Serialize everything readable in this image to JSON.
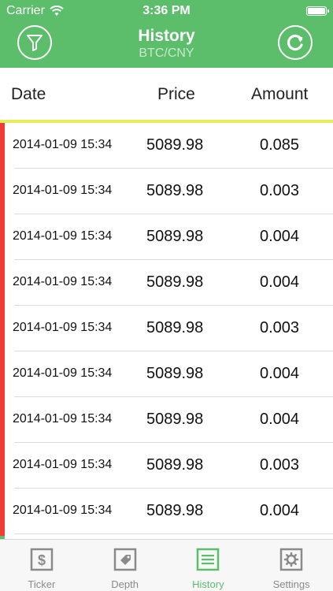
{
  "status_bar": {
    "carrier": "Carrier",
    "time": "3:36 PM"
  },
  "nav": {
    "title": "History",
    "subtitle": "BTC/CNY",
    "left_icon": "filter-icon",
    "right_icon": "refresh-icon"
  },
  "columns": {
    "date": "Date",
    "price": "Price",
    "amount": "Amount"
  },
  "trades": [
    {
      "date": "2014-01-09 15:34",
      "price": "5089.98",
      "amount": "0.085"
    },
    {
      "date": "2014-01-09 15:34",
      "price": "5089.98",
      "amount": "0.003"
    },
    {
      "date": "2014-01-09 15:34",
      "price": "5089.98",
      "amount": "0.004"
    },
    {
      "date": "2014-01-09 15:34",
      "price": "5089.98",
      "amount": "0.004"
    },
    {
      "date": "2014-01-09 15:34",
      "price": "5089.98",
      "amount": "0.003"
    },
    {
      "date": "2014-01-09 15:34",
      "price": "5089.98",
      "amount": "0.004"
    },
    {
      "date": "2014-01-09 15:34",
      "price": "5089.98",
      "amount": "0.004"
    },
    {
      "date": "2014-01-09 15:34",
      "price": "5089.98",
      "amount": "0.003"
    },
    {
      "date": "2014-01-09 15:34",
      "price": "5089.98",
      "amount": "0.004"
    }
  ],
  "tabs": [
    {
      "label": "Ticker",
      "icon": "dollar-icon",
      "active": false
    },
    {
      "label": "Depth",
      "icon": "tag-icon",
      "active": false
    },
    {
      "label": "History",
      "icon": "list-icon",
      "active": true
    },
    {
      "label": "Settings",
      "icon": "gear-icon",
      "active": false
    }
  ],
  "colors": {
    "accent_green": "#5cbd6b",
    "sell_red": "#ef3d35",
    "divider_yellow": "#e3ee5e",
    "subtitle": "#c6e8cc"
  }
}
